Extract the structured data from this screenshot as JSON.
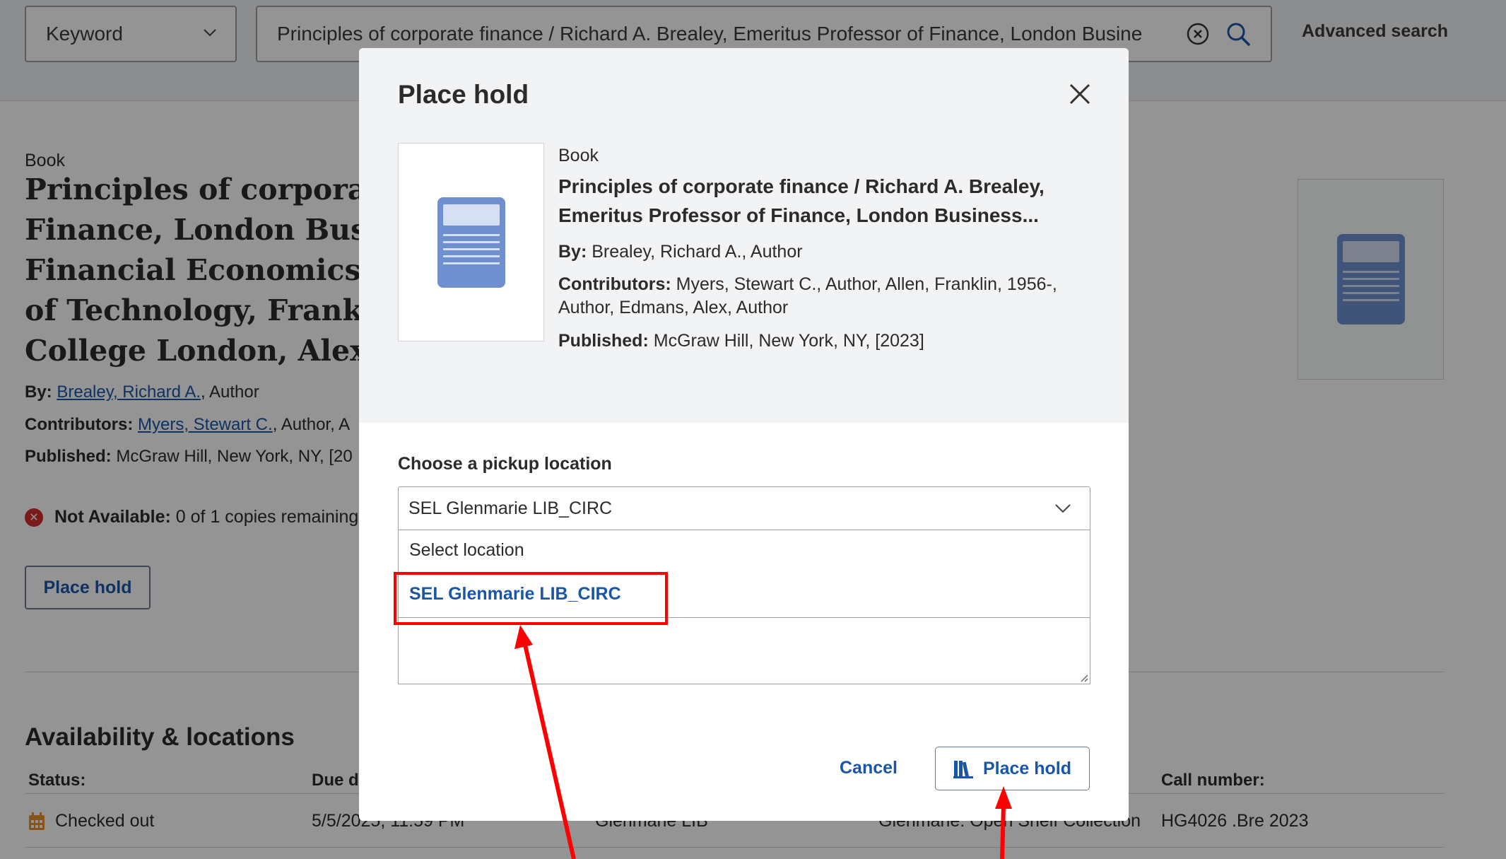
{
  "search": {
    "scope_label": "Keyword",
    "query": "Principles of corporate finance / Richard A. Brealey, Emeritus Professor of Finance, London Busine",
    "advanced_label": "Advanced search"
  },
  "record": {
    "type": "Book",
    "title_lines": [
      "Principles of corporate",
      "Finance, London Busin",
      "Financial Economics, S",
      "of Technology, Frankli",
      "College London, Alex E"
    ],
    "by_label": "By:",
    "by_link": "Brealey, Richard A.",
    "by_role": ", Author",
    "contributors_label": "Contributors:",
    "contributors_link": "Myers, Stewart C.",
    "contributors_rest": ", Author, A",
    "published_label": "Published:",
    "published_value": "McGraw Hill, New York, NY, [20",
    "availability_label": "Not Available:",
    "availability_value": "0 of 1 copies remaining",
    "place_hold_label": "Place hold"
  },
  "availability": {
    "heading": "Availability & locations",
    "headers": [
      "Status:",
      "Due d",
      "Call number:"
    ],
    "row": {
      "status": "Checked out",
      "due": "5/5/2025, 11:59 PM",
      "library": "Glenmarie LIB",
      "collection": "Glenmarie: Open Shelf Collection",
      "call_number": "HG4026 .Bre 2023"
    }
  },
  "modal": {
    "title": "Place hold",
    "item_type": "Book",
    "item_title": "Principles of corporate finance / Richard A. Brealey, Emeritus Professor of Finance, London Business...",
    "by_label": "By:",
    "by_value": "Brealey, Richard A., Author",
    "contributors_label": "Contributors:",
    "contributors_value": "Myers, Stewart C., Author, Allen, Franklin, 1956-, Author, Edmans, Alex, Author",
    "published_label": "Published:",
    "published_value": "McGraw Hill, New York, NY, [2023]",
    "pickup_label": "Choose a pickup location",
    "selected_location": "SEL Glenmarie LIB_CIRC",
    "options": [
      "Select location",
      "SEL Glenmarie LIB_CIRC"
    ],
    "cancel_label": "Cancel",
    "submit_label": "Place hold"
  },
  "colors": {
    "link_blue": "#1a56a8",
    "annotation_red": "#ff0000",
    "thumbnail_blue": "#6f8fcf"
  }
}
